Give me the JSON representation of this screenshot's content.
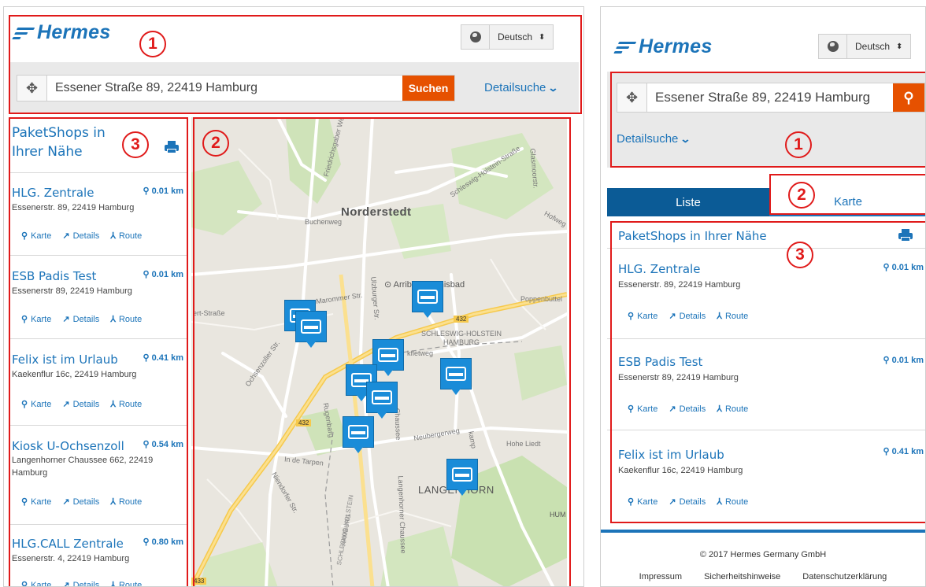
{
  "brand": {
    "logo": "Hermes"
  },
  "language": {
    "selected": "Deutsch"
  },
  "search": {
    "value": "Essener Straße 89, 22419 Hamburg",
    "button": "Suchen",
    "detail": "Detailsuche"
  },
  "list": {
    "title_line1": "PaketShops in",
    "title_line2": "Ihrer Nähe",
    "title_full": "PaketShops in Ihrer Nähe",
    "action_map": "Karte",
    "action_details": "Details",
    "action_route": "Route",
    "shops": [
      {
        "name": "HLG. Zentrale",
        "distance": "0.01 km",
        "address": "Essenerstr. 89, 22419 Hamburg"
      },
      {
        "name": "ESB Padis Test",
        "distance": "0.01 km",
        "address": "Essenerstr 89, 22419 Hamburg"
      },
      {
        "name": "Felix ist im Urlaub",
        "distance": "0.41 km",
        "address": "Kaekenflur 16c, 22419 Hamburg"
      },
      {
        "name": "Kiosk U-Ochsenzoll",
        "distance": "0.54 km",
        "address_line1": "Langenhorner Chaussee 662, 22419",
        "address_line2": "Hamburg"
      },
      {
        "name": "HLG.CALL Zentrale",
        "distance": "0.80 km",
        "address": "Essenerstr. 4, 22419 Hamburg"
      }
    ]
  },
  "map": {
    "labels": {
      "norderstedt": "Norderstedt",
      "arriba": "Arriba Erlebnisbad",
      "langenhorn": "LANGENHORN",
      "sh_hamburg_1": "SCHLESWIG-HOLSTEIN",
      "sh_hamburg_2": "HAMBURG",
      "road_432_a": "432",
      "road_432_b": "432",
      "road_433": "433",
      "buchenweg": "Buchenweg",
      "marommer": "Marommer Str.",
      "poppenbuttel": "Poppenbuttel",
      "ochsenzoller": "Ochsenzoller Str.",
      "rugenbarg": "Rugenbarg",
      "chaussee": "Chaussee",
      "neubergerweg": "Neubergerweg",
      "hohe_liedt": "Hohe Liedt",
      "tarpen": "In de Tarpen",
      "schleswig_holstein_str": "Schleswig-Holstein-Straße",
      "friedrichsgaber": "Friedrichsgaber Weg",
      "hum": "HUM",
      "ert_strasse": "ert-Straße",
      "kfletweg": "kfletweg",
      "hofweg": "Hofweg",
      "glasmoor": "Glasmoorstr.",
      "uizburger": "Ulzburger Str.",
      "kamp": "kamp",
      "niendorfer": "Niendorfer Str.",
      "sh_hamburg_v1": "SCHLESWIG-HOLSTEIN",
      "sh_hamburg_v2": "HAMBURG",
      "langenhorner_ch": "Langenhorner Chaussee"
    }
  },
  "tabs": {
    "list": "Liste",
    "map": "Karte"
  },
  "footer": {
    "copyright": "© 2017 Hermes Germany GmbH",
    "links": [
      "Impressum",
      "Sicherheitshinweise",
      "Datenschutzerklärung"
    ]
  },
  "annotations": {
    "a1": "1",
    "a2": "2",
    "a3": "3"
  },
  "colors": {
    "brand_blue": "#1c74b9",
    "accent_orange": "#e65100",
    "annotation_red": "#e01a1a",
    "pin_blue": "#1a8cd8"
  }
}
